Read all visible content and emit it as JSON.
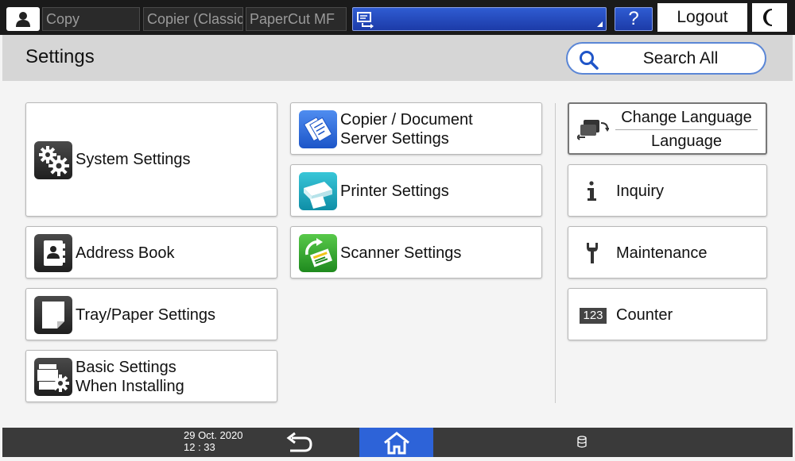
{
  "topbar": {
    "user_icon": "user-icon",
    "apps": [
      "Copy",
      "Copier (Classic)",
      "PaperCut MF"
    ],
    "screen_icon": "screen-switch-icon",
    "help_label": "?",
    "logout_label": "Logout",
    "night_icon": "moon-icon"
  },
  "header": {
    "title": "Settings",
    "search_label": "Search All",
    "search_icon": "search-icon"
  },
  "buttons": {
    "system_settings": "System Settings",
    "copier_line1": "Copier / Document",
    "copier_line2": "Server Settings",
    "printer_settings": "Printer Settings",
    "scanner_settings": "Scanner Settings",
    "address_book": "Address Book",
    "tray_paper": "Tray/Paper Settings",
    "basic_line1": "Basic Settings",
    "basic_line2": "When Installing",
    "change_language": "Change Language",
    "language": "Language",
    "inquiry": "Inquiry",
    "maintenance": "Maintenance",
    "counter": "Counter",
    "counter_icon_text": "123"
  },
  "bottombar": {
    "date": "29 Oct. 2020",
    "time": "12 : 33"
  },
  "colors": {
    "accent_blue": "#2d63d8",
    "topbar_bg": "#1a1a1a",
    "header_bg": "#d6d6d6"
  }
}
